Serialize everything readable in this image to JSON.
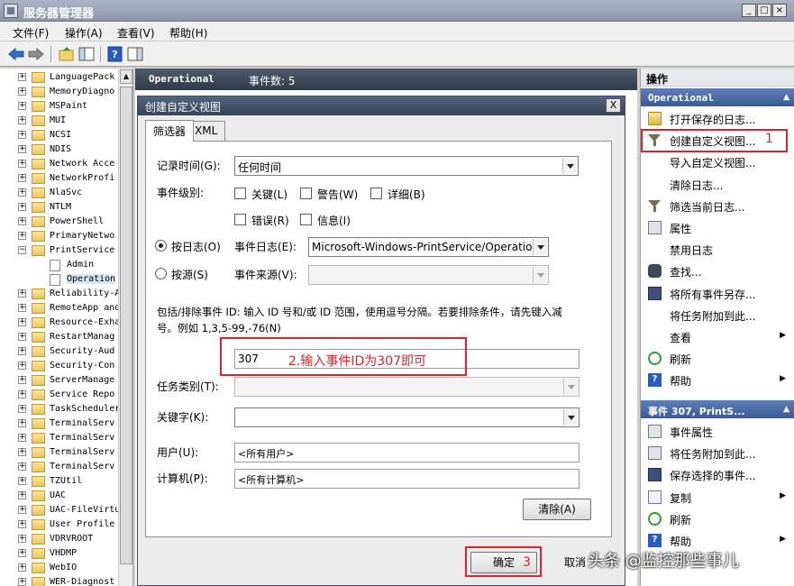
{
  "window": {
    "title": "服务器管理器"
  },
  "menu": [
    "文件(F)",
    "操作(A)",
    "查看(V)",
    "帮助(H)"
  ],
  "tree": {
    "items": [
      {
        "label": "LanguagePack",
        "expanded": false
      },
      {
        "label": "MemoryDiagno",
        "expanded": false
      },
      {
        "label": "MSPaint",
        "expanded": false
      },
      {
        "label": "MUI",
        "expanded": false
      },
      {
        "label": "NCSI",
        "expanded": false
      },
      {
        "label": "NDIS",
        "expanded": false
      },
      {
        "label": "Network Acce",
        "expanded": false
      },
      {
        "label": "NetworkProfi",
        "expanded": false
      },
      {
        "label": "NlaSvc",
        "expanded": false
      },
      {
        "label": "NTLM",
        "expanded": false
      },
      {
        "label": "PowerShell",
        "expanded": false
      },
      {
        "label": "PrimaryNetwo",
        "expanded": false
      },
      {
        "label": "PrintService",
        "expanded": true
      },
      {
        "label": "Admin",
        "child": true
      },
      {
        "label": "Operation",
        "child": true,
        "selected": true
      },
      {
        "label": "Reliability-A",
        "expanded": false
      },
      {
        "label": "RemoteApp and",
        "expanded": false
      },
      {
        "label": "Resource-Exha",
        "expanded": false
      },
      {
        "label": "RestartManag",
        "expanded": false
      },
      {
        "label": "Security-Aud",
        "expanded": false
      },
      {
        "label": "Security-Con",
        "expanded": false
      },
      {
        "label": "ServerManage",
        "expanded": false
      },
      {
        "label": "Service Repo",
        "expanded": false
      },
      {
        "label": "TaskScheduler",
        "expanded": false
      },
      {
        "label": "TerminalServ",
        "expanded": false
      },
      {
        "label": "TerminalServ",
        "expanded": false
      },
      {
        "label": "TerminalServ",
        "expanded": false
      },
      {
        "label": "TerminalServ",
        "expanded": false
      },
      {
        "label": "TZUtil",
        "expanded": false
      },
      {
        "label": "UAC",
        "expanded": false
      },
      {
        "label": "UAC-FileVirtu",
        "expanded": false
      },
      {
        "label": "User Profile",
        "expanded": false
      },
      {
        "label": "VDRVROOT",
        "expanded": false
      },
      {
        "label": "VHDMP",
        "expanded": false
      },
      {
        "label": "WebIO",
        "expanded": false
      },
      {
        "label": "WER-Diagnost",
        "expanded": false
      }
    ]
  },
  "center": {
    "log_name": "Operational",
    "event_count": "事件数: 5"
  },
  "actions": {
    "title": "操作",
    "section1": "Operational",
    "items1": [
      {
        "label": "打开保存的日志...",
        "icon": "folder-icon"
      },
      {
        "label": "创建自定义视图...",
        "icon": "filter-icon"
      },
      {
        "label": "导入自定义视图...",
        "icon": ""
      },
      {
        "label": "清除日志...",
        "icon": ""
      },
      {
        "label": "筛选当前日志...",
        "icon": "filter-icon"
      },
      {
        "label": "属性",
        "icon": "properties-icon"
      },
      {
        "label": "禁用日志",
        "icon": ""
      },
      {
        "label": "查找...",
        "icon": "find-icon"
      },
      {
        "label": "将所有事件另存...",
        "icon": "save-icon"
      },
      {
        "label": "将任务附加到此...",
        "icon": ""
      },
      {
        "label": "查看",
        "icon": "",
        "submenu": true
      },
      {
        "label": "刷新",
        "icon": "refresh-icon"
      },
      {
        "label": "帮助",
        "icon": "help-icon",
        "submenu": true
      }
    ],
    "section2": "事件 307, PrintS...",
    "items2": [
      {
        "label": "事件属性",
        "icon": "properties-icon"
      },
      {
        "label": "将任务附加到此...",
        "icon": "task-icon"
      },
      {
        "label": "保存选择的事件...",
        "icon": "save-icon"
      },
      {
        "label": "复制",
        "icon": "copy-icon",
        "submenu": true
      },
      {
        "label": "刷新",
        "icon": "refresh-icon"
      },
      {
        "label": "帮助",
        "icon": "help-icon",
        "submenu": true
      }
    ]
  },
  "dialog": {
    "title": "创建自定义视图",
    "close": "X",
    "tabs": [
      "筛选器",
      "XML"
    ],
    "logged_label": "记录时间(G):",
    "logged_value": "任何时间",
    "level_label": "事件级别:",
    "levels": [
      "关键(L)",
      "警告(W)",
      "详细(B)",
      "错误(R)",
      "信息(I)"
    ],
    "by_log_label": "按日志(O)",
    "event_logs_label": "事件日志(E):",
    "event_logs_value": "Microsoft-Windows-PrintService/Operation",
    "by_source_label": "按源(S)",
    "event_sources_label": "事件来源(V):",
    "ids_help_line1": "包括/排除事件 ID: 输入 ID 号和/或 ID 范围，使用逗号分隔。若要排除条件，请先键入减",
    "ids_help_line2": "号。例如 1,3,5-99,-76(N)",
    "event_id_value": "307",
    "task_category_label": "任务类别(T):",
    "keywords_label": "关键字(K):",
    "user_label": "用户(U):",
    "user_value": "<所有用户>",
    "computer_label": "计算机(P):",
    "computer_value": "<所有计算机>",
    "clear_button": "清除(A)",
    "ok_button": "确定",
    "cancel_button": "取消"
  },
  "annotations": {
    "a1": "1",
    "a2": "2.输入事件ID为307即可",
    "a3": "3"
  },
  "watermark": "头条 @监控那些事儿",
  "colors": {
    "annotation_red": "#d9262c",
    "action_header": "#3b5a96"
  }
}
